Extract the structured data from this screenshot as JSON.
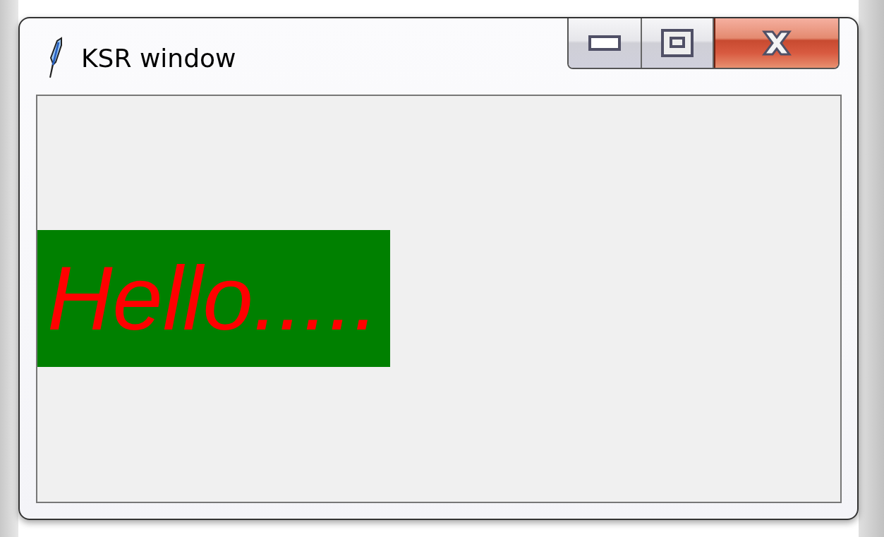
{
  "window": {
    "title": "KSR window"
  },
  "label": {
    "text": "Hello....."
  }
}
